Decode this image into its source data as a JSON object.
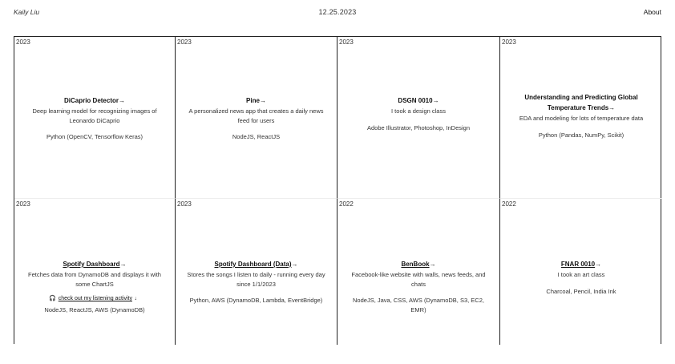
{
  "header": {
    "name": "Kaily Liu",
    "date": "12.25.2023",
    "about": "About"
  },
  "projects": [
    {
      "year": "2023",
      "title": "DiCaprio Detector",
      "arrow": "→",
      "description": "Deep learning model for recognizing images of Leonardo DiCaprio",
      "tech": "Python (OpenCV, Tensorflow Keras)"
    },
    {
      "year": "2023",
      "title": "Pine",
      "arrow": "→",
      "description": "A personalized news app that creates a daily news feed for users",
      "tech": "NodeJS, ReactJS"
    },
    {
      "year": "2023",
      "title": "DSGN 0010",
      "arrow": "→",
      "description": "I took a design class",
      "tech": "Adobe Illustrator, Photoshop, InDesign"
    },
    {
      "year": "2023",
      "title": "Understanding and Predicting Global Temperature Trends",
      "arrow": "→",
      "description": "EDA and modeling for lots of temperature data",
      "tech": "Python (Pandas, NumPy, Scikit)"
    },
    {
      "year": "2023",
      "title": "Spotify Dashboard",
      "arrow": "→",
      "description": "Fetches data from DynamoDB and displays it with some ChartJS",
      "listen": "check out my listening activity",
      "tech": "NodeJS, ReactJS, AWS (DynamoDB)"
    },
    {
      "year": "2023",
      "title": "Spotify Dashboard (Data)",
      "arrow": "→",
      "description": "Stores the songs I listen to daily - running every day since 1/1/2023",
      "tech": "Python, AWS (DynamoDB, Lambda, EventBridge)"
    },
    {
      "year": "2022",
      "title": "BenBook",
      "arrow": "→",
      "description": "Facebook-like website with walls, news feeds, and chats",
      "tech": "NodeJS, Java, CSS, AWS (DynamoDB, S3, EC2, EMR)"
    },
    {
      "year": "2022",
      "title": "FNAR 0010",
      "arrow": "→",
      "description": "I took an art class",
      "tech": "Charcoal, Pencil, India Ink"
    }
  ]
}
